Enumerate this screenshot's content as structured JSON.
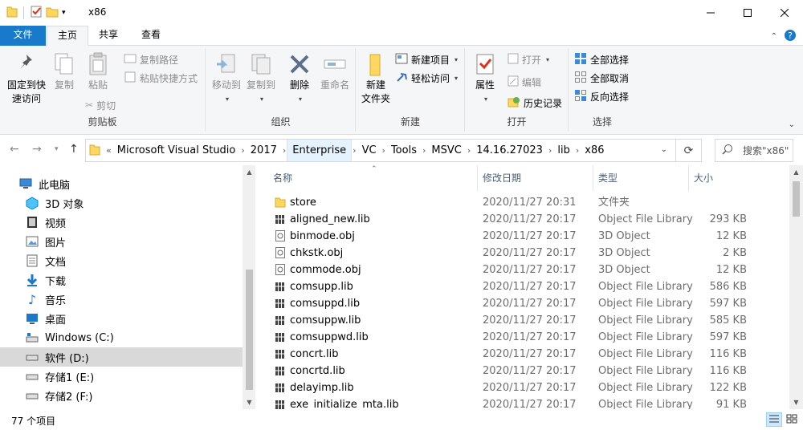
{
  "window": {
    "title": "x86"
  },
  "ribbon_tabs": {
    "file": "文件",
    "home": "主页",
    "share": "共享",
    "view": "查看"
  },
  "ribbon": {
    "clipboard": {
      "label": "剪贴板",
      "pin_line1": "固定到快",
      "pin_line2": "速访问",
      "copy": "复制",
      "paste": "粘贴",
      "copy_path": "复制路径",
      "paste_shortcut": "粘贴快捷方式",
      "cut": "剪切"
    },
    "organize": {
      "label": "组织",
      "move_to": "移动到",
      "copy_to": "复制到",
      "delete": "删除",
      "rename": "重命名"
    },
    "new": {
      "label": "新建",
      "new_item": "新建项目",
      "easy_access": "轻松访问",
      "new_folder_line1": "新建",
      "new_folder_line2": "文件夹"
    },
    "open": {
      "label": "打开",
      "properties": "属性",
      "open": "打开",
      "edit": "编辑",
      "history": "历史记录"
    },
    "select": {
      "label": "选择",
      "select_all": "全部选择",
      "select_none": "全部取消",
      "invert": "反向选择"
    }
  },
  "address": {
    "overflow": "«",
    "crumbs": [
      "Microsoft Visual Studio",
      "2017",
      "Enterprise",
      "VC",
      "Tools",
      "MSVC",
      "14.16.27023",
      "lib",
      "x86"
    ],
    "search_placeholder": "搜索\"x86\""
  },
  "nav": {
    "items": [
      {
        "label": "此电脑",
        "icon": "computer-icon"
      },
      {
        "label": "3D 对象",
        "icon": "3d-objects-icon"
      },
      {
        "label": "视频",
        "icon": "video-icon"
      },
      {
        "label": "图片",
        "icon": "pictures-icon"
      },
      {
        "label": "文档",
        "icon": "documents-icon"
      },
      {
        "label": "下载",
        "icon": "download-icon"
      },
      {
        "label": "音乐",
        "icon": "music-icon"
      },
      {
        "label": "桌面",
        "icon": "desktop-icon"
      },
      {
        "label": "Windows (C:)",
        "icon": "windows-drive-icon"
      },
      {
        "label": "软件 (D:)",
        "icon": "drive-icon"
      },
      {
        "label": "存储1 (E:)",
        "icon": "drive-icon"
      },
      {
        "label": "存储2 (F:)",
        "icon": "drive-icon"
      }
    ]
  },
  "columns": {
    "name": "名称",
    "date": "修改日期",
    "type": "类型",
    "size": "大小"
  },
  "files": [
    {
      "name": "store",
      "date": "2020/11/27 20:31",
      "type": "文件夹",
      "size": "",
      "icon": "folder-icon"
    },
    {
      "name": "aligned_new.lib",
      "date": "2020/11/27 20:17",
      "type": "Object File Library",
      "size": "293 KB",
      "icon": "library-file-icon"
    },
    {
      "name": "binmode.obj",
      "date": "2020/11/27 20:17",
      "type": "3D Object",
      "size": "12 KB",
      "icon": "object-file-icon"
    },
    {
      "name": "chkstk.obj",
      "date": "2020/11/27 20:17",
      "type": "3D Object",
      "size": "2 KB",
      "icon": "object-file-icon"
    },
    {
      "name": "commode.obj",
      "date": "2020/11/27 20:17",
      "type": "3D Object",
      "size": "12 KB",
      "icon": "object-file-icon"
    },
    {
      "name": "comsupp.lib",
      "date": "2020/11/27 20:17",
      "type": "Object File Library",
      "size": "586 KB",
      "icon": "library-file-icon"
    },
    {
      "name": "comsuppd.lib",
      "date": "2020/11/27 20:17",
      "type": "Object File Library",
      "size": "597 KB",
      "icon": "library-file-icon"
    },
    {
      "name": "comsuppw.lib",
      "date": "2020/11/27 20:17",
      "type": "Object File Library",
      "size": "585 KB",
      "icon": "library-file-icon"
    },
    {
      "name": "comsuppwd.lib",
      "date": "2020/11/27 20:17",
      "type": "Object File Library",
      "size": "597 KB",
      "icon": "library-file-icon"
    },
    {
      "name": "concrt.lib",
      "date": "2020/11/27 20:17",
      "type": "Object File Library",
      "size": "116 KB",
      "icon": "library-file-icon"
    },
    {
      "name": "concrtd.lib",
      "date": "2020/11/27 20:17",
      "type": "Object File Library",
      "size": "116 KB",
      "icon": "library-file-icon"
    },
    {
      "name": "delayimp.lib",
      "date": "2020/11/27 20:17",
      "type": "Object File Library",
      "size": "122 KB",
      "icon": "library-file-icon"
    },
    {
      "name": "exe_initialize_mta.lib",
      "date": "2020/11/27 20:17",
      "type": "Object File Library",
      "size": "91 KB",
      "icon": "library-file-icon"
    }
  ],
  "status": {
    "count": "77 个项目"
  },
  "colors": {
    "accent": "#1979ca",
    "folder": "#ffd75e",
    "selection": "#cce8ff"
  }
}
